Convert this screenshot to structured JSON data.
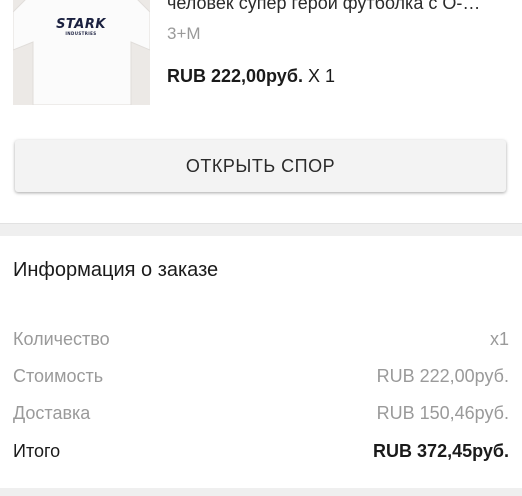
{
  "product": {
    "title": "человек супер герой футболка с О-…",
    "variant": "3+M",
    "price": "RUB 222,00руб.",
    "quantity": "X 1",
    "image_logo": "STARK",
    "image_logo_sub": "INDUSTRIES"
  },
  "dispute_button": {
    "label": "ОТКРЫТЬ СПОР"
  },
  "order_info": {
    "title": "Информация о заказе",
    "rows": [
      {
        "label": "Количество",
        "value": "x1"
      },
      {
        "label": "Стоимость",
        "value": "RUB 222,00руб."
      },
      {
        "label": "Доставка",
        "value": "RUB 150,46руб."
      },
      {
        "label": "Итого",
        "value": "RUB 372,45руб."
      }
    ]
  },
  "colors": {
    "text_primary": "#1a1a1a",
    "text_secondary": "#9a9a9a",
    "button_bg": "#f3f3f3",
    "section_gap": "#efefef"
  }
}
